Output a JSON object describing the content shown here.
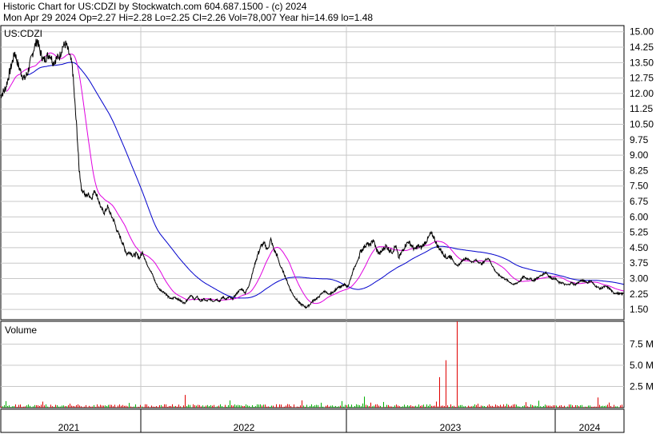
{
  "header": {
    "line1": "Historic Chart for US:CDZI by Stockwatch.com 604.687.1500 - (c) 2024",
    "line2": "Mon Apr 29 2024  Op=2.27  Hi=2.28  Lo=2.25  Cl=2.26  Vol=78,007  Year hi=14.69  lo=1.48"
  },
  "chart_data": [
    {
      "type": "line",
      "panel": "price",
      "label": "US:CDZI",
      "ylim": [
        1.0,
        15.3
      ],
      "y_ticks": [
        "15.00",
        "14.25",
        "13.50",
        "12.75",
        "12.00",
        "11.25",
        "10.50",
        "9.75",
        "9.00",
        "8.25",
        "7.50",
        "6.75",
        "6.00",
        "5.25",
        "4.50",
        "3.75",
        "3.00",
        "2.25",
        "1.50"
      ],
      "x_labels": [
        "2021",
        "2022",
        "2023",
        "2024"
      ],
      "grid": true,
      "colors": {
        "price": "#000000",
        "ma_short": "#e000e0",
        "ma_long": "#0000cc"
      },
      "price_anchors": [
        [
          0,
          11.9
        ],
        [
          6,
          12.2
        ],
        [
          10,
          12.8
        ],
        [
          14,
          13.4
        ],
        [
          18,
          14.0
        ],
        [
          22,
          13.4
        ],
        [
          26,
          13.0
        ],
        [
          30,
          12.7
        ],
        [
          34,
          13.0
        ],
        [
          38,
          13.6
        ],
        [
          42,
          14.2
        ],
        [
          46,
          14.6
        ],
        [
          50,
          14.0
        ],
        [
          54,
          13.6
        ],
        [
          58,
          13.8
        ],
        [
          62,
          13.9
        ],
        [
          66,
          13.5
        ],
        [
          70,
          13.7
        ],
        [
          74,
          13.8
        ],
        [
          78,
          14.3
        ],
        [
          82,
          14.4
        ],
        [
          86,
          13.9
        ],
        [
          90,
          13.3
        ],
        [
          94,
          11.0
        ],
        [
          96,
          10.0
        ],
        [
          98,
          8.5
        ],
        [
          100,
          7.8
        ],
        [
          102,
          7.2
        ],
        [
          104,
          7.3
        ],
        [
          106,
          7.0
        ],
        [
          110,
          7.1
        ],
        [
          114,
          6.9
        ],
        [
          118,
          7.3
        ],
        [
          122,
          6.9
        ],
        [
          126,
          6.4
        ],
        [
          130,
          6.2
        ],
        [
          134,
          6.5
        ],
        [
          138,
          6.1
        ],
        [
          142,
          5.8
        ],
        [
          146,
          5.3
        ],
        [
          150,
          5.0
        ],
        [
          154,
          4.6
        ],
        [
          158,
          4.2
        ],
        [
          162,
          4.3
        ],
        [
          166,
          4.1
        ],
        [
          170,
          4.2
        ],
        [
          174,
          4.0
        ],
        [
          178,
          4.3
        ],
        [
          182,
          3.8
        ],
        [
          186,
          3.5
        ],
        [
          190,
          3.2
        ],
        [
          194,
          2.8
        ],
        [
          198,
          2.5
        ],
        [
          202,
          2.4
        ],
        [
          206,
          2.3
        ],
        [
          210,
          2.1
        ],
        [
          214,
          2.0
        ],
        [
          218,
          2.1
        ],
        [
          222,
          2.0
        ],
        [
          226,
          1.9
        ],
        [
          230,
          1.8
        ],
        [
          234,
          2.0
        ],
        [
          238,
          2.2
        ],
        [
          242,
          2.0
        ],
        [
          246,
          2.1
        ],
        [
          250,
          1.9
        ],
        [
          254,
          2.0
        ],
        [
          258,
          1.9
        ],
        [
          262,
          2.0
        ],
        [
          266,
          1.9
        ],
        [
          270,
          2.0
        ],
        [
          274,
          1.9
        ],
        [
          278,
          2.1
        ],
        [
          282,
          2.0
        ],
        [
          286,
          2.1
        ],
        [
          290,
          2.0
        ],
        [
          294,
          2.2
        ],
        [
          298,
          2.4
        ],
        [
          302,
          2.5
        ],
        [
          306,
          2.3
        ],
        [
          310,
          2.6
        ],
        [
          314,
          3.1
        ],
        [
          318,
          3.7
        ],
        [
          322,
          4.2
        ],
        [
          326,
          4.6
        ],
        [
          330,
          4.7
        ],
        [
          334,
          4.4
        ],
        [
          338,
          4.9
        ],
        [
          342,
          4.4
        ],
        [
          346,
          4.1
        ],
        [
          350,
          3.6
        ],
        [
          354,
          3.3
        ],
        [
          358,
          2.9
        ],
        [
          362,
          2.5
        ],
        [
          366,
          2.2
        ],
        [
          370,
          2.0
        ],
        [
          374,
          1.8
        ],
        [
          378,
          1.7
        ],
        [
          382,
          1.6
        ],
        [
          386,
          1.7
        ],
        [
          390,
          1.9
        ],
        [
          394,
          2.0
        ],
        [
          398,
          2.1
        ],
        [
          402,
          2.3
        ],
        [
          406,
          2.4
        ],
        [
          410,
          2.2
        ],
        [
          414,
          2.3
        ],
        [
          418,
          2.4
        ],
        [
          422,
          2.6
        ],
        [
          426,
          2.6
        ],
        [
          430,
          2.7
        ],
        [
          434,
          2.6
        ],
        [
          438,
          3.0
        ],
        [
          442,
          3.5
        ],
        [
          446,
          3.8
        ],
        [
          450,
          4.3
        ],
        [
          454,
          4.5
        ],
        [
          458,
          4.7
        ],
        [
          462,
          4.6
        ],
        [
          466,
          4.9
        ],
        [
          470,
          4.4
        ],
        [
          474,
          4.2
        ],
        [
          478,
          4.4
        ],
        [
          482,
          4.6
        ],
        [
          486,
          4.4
        ],
        [
          490,
          4.3
        ],
        [
          494,
          4.6
        ],
        [
          498,
          4.0
        ],
        [
          502,
          4.3
        ],
        [
          506,
          4.6
        ],
        [
          510,
          4.8
        ],
        [
          514,
          4.6
        ],
        [
          518,
          4.4
        ],
        [
          522,
          4.6
        ],
        [
          526,
          4.5
        ],
        [
          530,
          4.7
        ],
        [
          534,
          4.9
        ],
        [
          538,
          5.2
        ],
        [
          542,
          5.0
        ],
        [
          546,
          4.6
        ],
        [
          550,
          4.4
        ],
        [
          554,
          4.2
        ],
        [
          558,
          4.0
        ],
        [
          562,
          4.1
        ],
        [
          566,
          3.9
        ],
        [
          570,
          3.6
        ],
        [
          574,
          3.7
        ],
        [
          578,
          3.9
        ],
        [
          582,
          4.0
        ],
        [
          586,
          3.9
        ],
        [
          590,
          3.8
        ],
        [
          594,
          3.9
        ],
        [
          598,
          3.8
        ],
        [
          602,
          3.7
        ],
        [
          606,
          3.9
        ],
        [
          610,
          4.0
        ],
        [
          614,
          3.7
        ],
        [
          618,
          3.4
        ],
        [
          622,
          3.2
        ],
        [
          626,
          3.1
        ],
        [
          630,
          3.0
        ],
        [
          634,
          2.9
        ],
        [
          638,
          2.8
        ],
        [
          642,
          2.7
        ],
        [
          646,
          2.8
        ],
        [
          650,
          2.9
        ],
        [
          654,
          3.1
        ],
        [
          658,
          3.0
        ],
        [
          662,
          3.0
        ],
        [
          666,
          2.9
        ],
        [
          670,
          3.0
        ],
        [
          674,
          3.1
        ],
        [
          678,
          3.2
        ],
        [
          682,
          3.3
        ],
        [
          686,
          3.1
        ],
        [
          690,
          3.0
        ],
        [
          694,
          3.0
        ],
        [
          698,
          2.8
        ],
        [
          702,
          2.8
        ],
        [
          706,
          2.7
        ],
        [
          710,
          2.7
        ],
        [
          714,
          2.8
        ],
        [
          718,
          2.7
        ],
        [
          722,
          2.8
        ],
        [
          726,
          2.9
        ],
        [
          730,
          2.9
        ],
        [
          734,
          2.8
        ],
        [
          738,
          2.9
        ],
        [
          742,
          2.7
        ],
        [
          746,
          2.6
        ],
        [
          750,
          2.5
        ],
        [
          754,
          2.6
        ],
        [
          758,
          2.6
        ],
        [
          762,
          2.5
        ],
        [
          766,
          2.3
        ],
        [
          770,
          2.3
        ],
        [
          774,
          2.25
        ],
        [
          779,
          2.26
        ]
      ],
      "volume_unit": "M",
      "volume_ticks": [
        "7.5 M",
        "5.0 M",
        "2.5 M"
      ],
      "volume_ylim": [
        0,
        10.2
      ],
      "volume_spikes": [
        [
          96,
          2.7
        ],
        [
          72,
          0.9
        ],
        [
          40,
          0.6
        ],
        [
          130,
          0.5
        ],
        [
          156,
          0.8
        ],
        [
          200,
          0.5
        ],
        [
          231,
          1.5
        ],
        [
          300,
          2.9
        ],
        [
          336,
          0.5
        ],
        [
          376,
          0.7
        ],
        [
          455,
          1.3
        ],
        [
          470,
          0.6
        ],
        [
          502,
          1.5
        ],
        [
          549,
          3.6
        ],
        [
          557,
          5.6
        ],
        [
          571,
          10.2
        ],
        [
          618,
          1.1
        ],
        [
          700,
          0.9
        ],
        [
          747,
          1.2
        ]
      ]
    }
  ],
  "volume_label": "Volume"
}
